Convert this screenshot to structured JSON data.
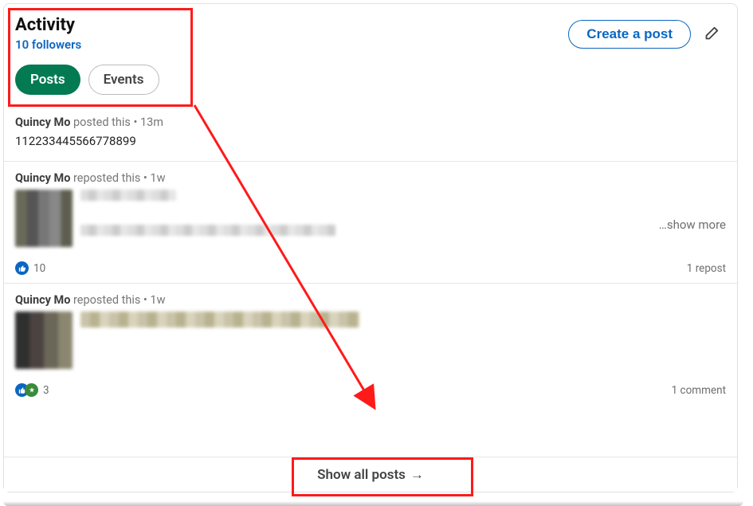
{
  "header": {
    "title": "Activity",
    "followers_text": "10 followers",
    "create_post_label": "Create a post"
  },
  "tabs": {
    "posts_label": "Posts",
    "events_label": "Events"
  },
  "posts": [
    {
      "author": "Quincy Mo",
      "action": " posted this • 13m",
      "body": "112233445566778899"
    },
    {
      "author": "Quincy Mo",
      "action": " reposted this • 1w",
      "show_more": "…show more",
      "reaction_count": "10",
      "right_meta": "1 repost"
    },
    {
      "author": "Quincy Mo",
      "action": " reposted this • 1w",
      "reaction_count": "3",
      "right_meta": "1 comment"
    }
  ],
  "footer": {
    "show_all_label": "Show all posts",
    "arrow_glyph": "→"
  }
}
